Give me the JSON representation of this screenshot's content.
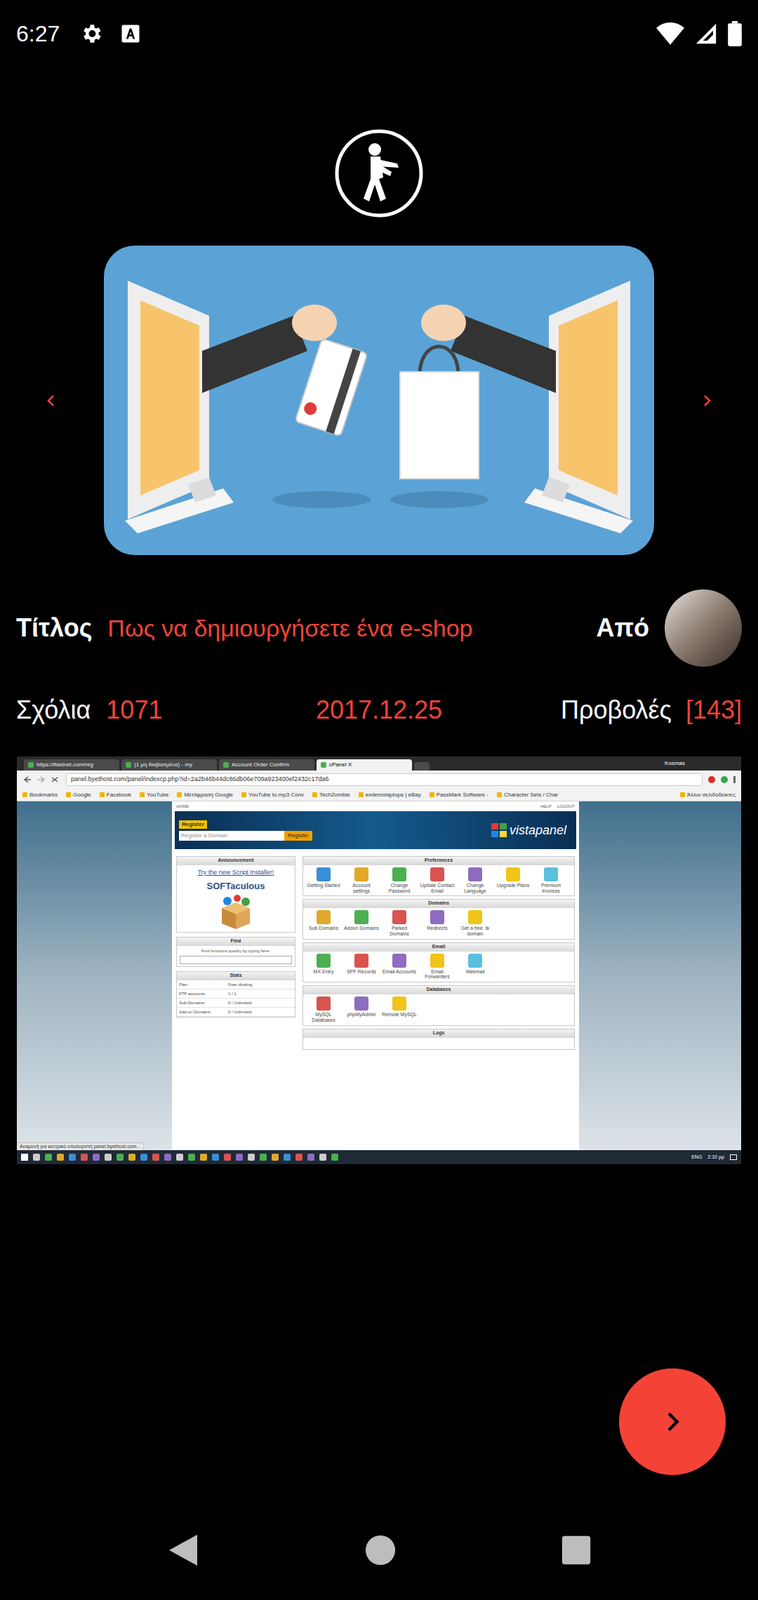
{
  "status_bar": {
    "time": "6:27"
  },
  "post": {
    "title_label": "Τίτλος",
    "title": "Πως να δημιουργήσετε ένα e-shop",
    "by_label": "Από",
    "comments_label": "Σχόλια",
    "comments": "1071",
    "date": "2017.12.25",
    "views_label": "Προβολές",
    "views": "[143]"
  },
  "screenshot": {
    "tabs": [
      {
        "label": "https://ifastnet.com/reg",
        "selected": false
      },
      {
        "label": "(1 μη διαβασμένα) - my",
        "selected": false
      },
      {
        "label": "Account Order Confirm",
        "selected": false
      },
      {
        "label": "cPanel X",
        "selected": true
      }
    ],
    "user": "Kosmas",
    "address": "panel.byethost.com/panel/indexcp.php?id=2a2b46b44dc86db06e709a923400ef2432c17da6",
    "bookmarks": [
      "Bookmarks",
      "Google",
      "Facebook",
      "YouTube",
      "Μετάφραση Google",
      "YouTube to mp3 Conv",
      "TechZombie",
      "exdemolaptops | eBay",
      "PassMark Software -",
      "Character Sets / Char",
      "Άλλοι σελιδοδείκτες"
    ],
    "page": {
      "home": "HOME",
      "help": "HELP",
      "logout": "LOGOUT",
      "register_tag": "Register",
      "domain_placeholder": "Register a Domain",
      "register_button": "Register",
      "logo": "vistapanel",
      "announcement": {
        "title": "Announcement",
        "link": "Try the new Script Installer!",
        "brand": "SOFTaculous"
      },
      "find": {
        "title": "Find",
        "hint": "Find functions quickly by typing here."
      },
      "stats": {
        "title": "Stats",
        "rows": [
          {
            "label": "Plan",
            "value": "Free Hosting"
          },
          {
            "label": "FTP accounts",
            "value": "1 / 1"
          },
          {
            "label": "Sub-Domains",
            "value": "0 / Unlimited"
          },
          {
            "label": "Add-on Domains",
            "value": "0 / Unlimited"
          }
        ]
      },
      "sections": [
        {
          "title": "Preferences",
          "items": [
            "Getting Started",
            "Account settings",
            "Change Password",
            "Update Contact Email",
            "Change Language",
            "Upgrade Plans",
            "Premium Invoices"
          ]
        },
        {
          "title": "Domains",
          "items": [
            "Sub Domains",
            "Addon Domains",
            "Parked Domains",
            "Redirects",
            "Get a free .tk domain"
          ]
        },
        {
          "title": "Email",
          "items": [
            "MX Entry",
            "SPF Records",
            "Email Accounts",
            "Email Forwarders",
            "Webmail"
          ]
        },
        {
          "title": "Databases",
          "items": [
            "MySQL Databases",
            "phpMyAdmin",
            "Remote MySQL"
          ]
        },
        {
          "title": "Logs",
          "items": []
        }
      ]
    },
    "status": "Αναμονή για κεντρικό υπολογιστή panel.byethost.com...",
    "tray": {
      "lang": "ENG",
      "time": "2:10 μμ"
    }
  }
}
